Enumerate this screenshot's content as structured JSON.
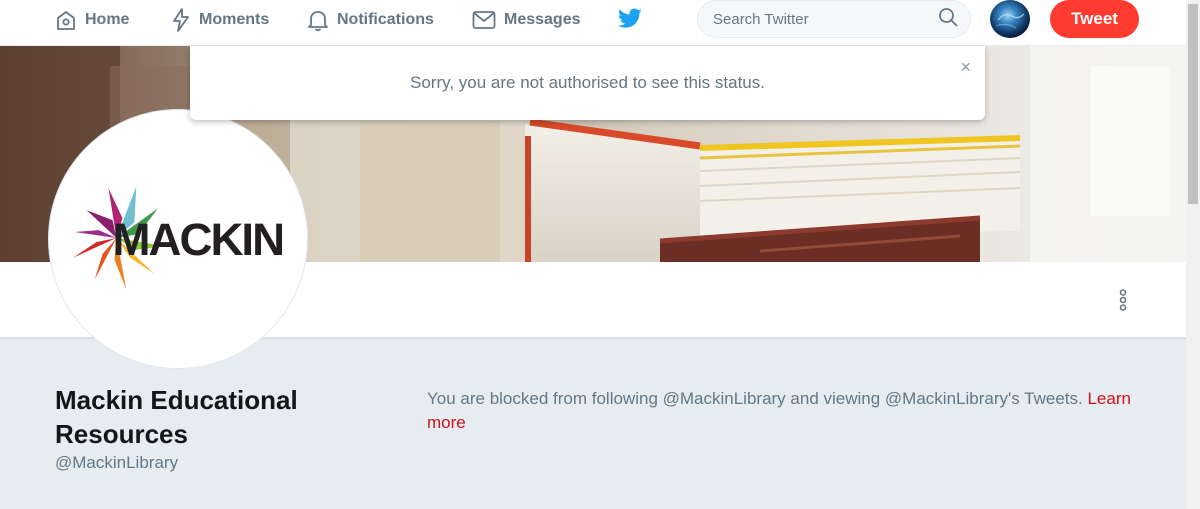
{
  "nav": {
    "home": "Home",
    "moments": "Moments",
    "notifications": "Notifications",
    "messages": "Messages",
    "search_placeholder": "Search Twitter",
    "tweet": "Tweet"
  },
  "alert": {
    "message": "Sorry, you are not authorised to see this status.",
    "close": "×"
  },
  "profile": {
    "name": "Mackin Educational Resources",
    "handle": "@MackinLibrary",
    "logo_text": "MACKIN",
    "blocked_text": "You are blocked from following @MackinLibrary and viewing @MackinLibrary's Tweets.",
    "learn_more": "Learn more"
  },
  "icons": {
    "home": "home-icon",
    "moments": "lightning-icon",
    "notifications": "bell-icon",
    "messages": "envelope-icon",
    "logo": "twitter-bird-icon",
    "search": "search-icon",
    "more": "more-vertical-icon"
  },
  "colors": {
    "tweet_button": "#ff3b30",
    "twitter_blue": "#1da1f2",
    "nav_text": "#657786",
    "link_red": "#d0111b",
    "page_background": "#e6ecf0"
  }
}
